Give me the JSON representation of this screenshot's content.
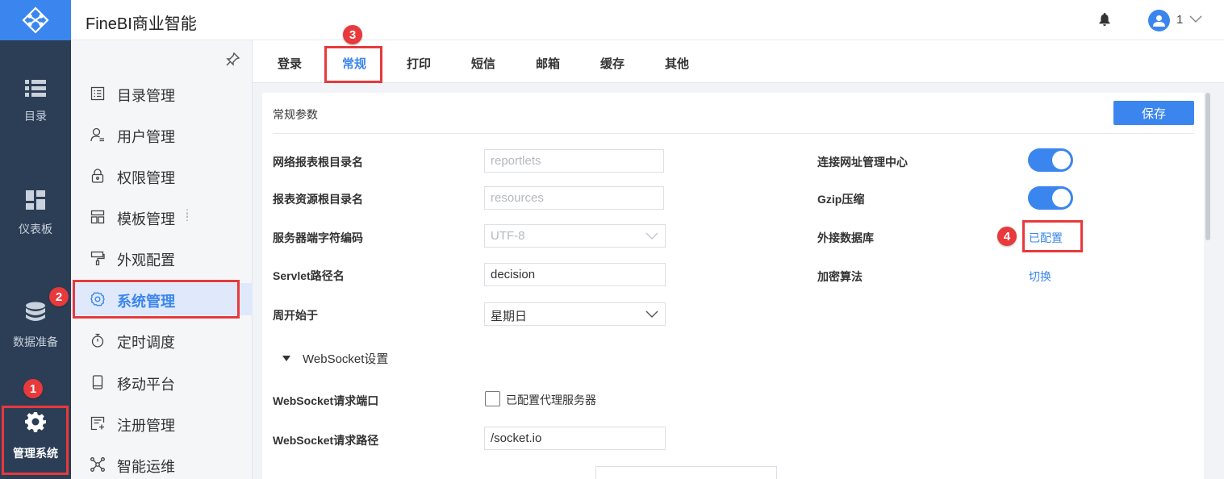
{
  "app": {
    "title": "FineBI商业智能",
    "user": "1"
  },
  "rail": {
    "items": [
      {
        "label": "目录",
        "icon": "list-icon"
      },
      {
        "label": "仪表板",
        "icon": "dashboard-icon"
      },
      {
        "label": "数据准备",
        "icon": "database-icon"
      },
      {
        "label": "管理系统",
        "icon": "gear-icon",
        "active": true
      }
    ]
  },
  "submenu": {
    "items": [
      {
        "label": "目录管理",
        "icon": "catalog-icon"
      },
      {
        "label": "用户管理",
        "icon": "user-icon"
      },
      {
        "label": "权限管理",
        "icon": "lock-icon"
      },
      {
        "label": "模板管理",
        "icon": "template-icon"
      },
      {
        "label": "外观配置",
        "icon": "brush-icon"
      },
      {
        "label": "系统管理",
        "icon": "settings-icon",
        "active": true
      },
      {
        "label": "定时调度",
        "icon": "timer-icon"
      },
      {
        "label": "移动平台",
        "icon": "mobile-icon"
      },
      {
        "label": "注册管理",
        "icon": "register-icon"
      },
      {
        "label": "智能运维",
        "icon": "network-icon"
      }
    ]
  },
  "tabs": [
    "登录",
    "常规",
    "打印",
    "短信",
    "邮箱",
    "缓存",
    "其他"
  ],
  "active_tab": "常规",
  "section": {
    "title": "常规参数",
    "save": "保存"
  },
  "form": {
    "report_root": {
      "label": "网络报表根目录名",
      "value": "reportlets"
    },
    "resource_root": {
      "label": "报表资源根目录名",
      "value": "resources"
    },
    "encoding": {
      "label": "服务器端字符编码",
      "value": "UTF-8"
    },
    "servlet": {
      "label": "Servlet路径名",
      "value": "decision"
    },
    "week_start": {
      "label": "周开始于",
      "value": "星期日"
    },
    "url_center": {
      "label": "连接网址管理中心",
      "on": true
    },
    "gzip": {
      "label": "Gzip压缩",
      "on": true
    },
    "ext_db": {
      "label": "外接数据库",
      "link": "已配置"
    },
    "encrypt": {
      "label": "加密算法",
      "link": "切换"
    }
  },
  "websocket": {
    "header": "WebSocket设置",
    "port_label": "WebSocket请求端口",
    "proxy_checkbox": "已配置代理服务器",
    "path_label": "WebSocket请求路径",
    "path_value": "/socket.io"
  },
  "annotations": [
    "1",
    "2",
    "3",
    "4"
  ],
  "colors": {
    "accent": "#3b86ee",
    "rail": "#2c3e56",
    "highlight": "#e8393c"
  }
}
